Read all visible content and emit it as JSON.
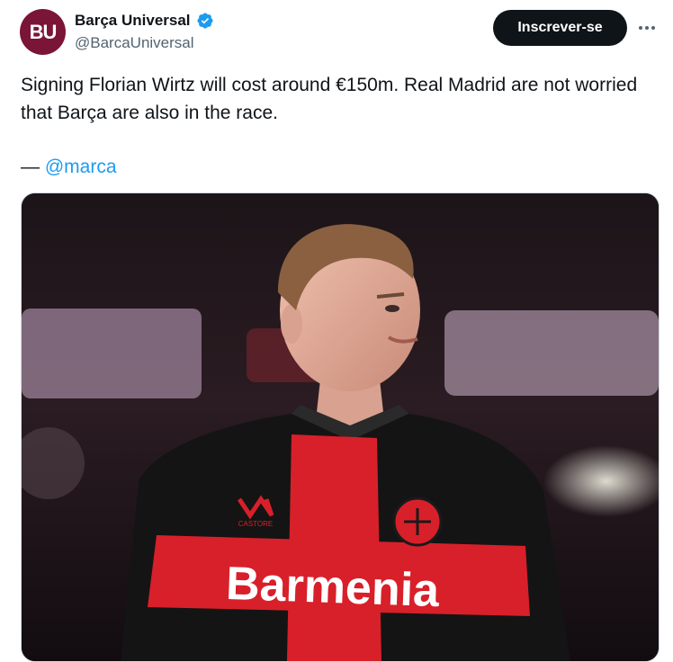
{
  "author": {
    "avatar_text": "BU",
    "name": "Barça Universal",
    "handle": "@BarcaUniversal",
    "verified_icon": "verified-badge-icon"
  },
  "actions": {
    "subscribe_label": "Inscrever-se",
    "more_icon": "more-options-icon"
  },
  "tweet": {
    "text": "Signing Florian Wirtz will cost around €150m. Real Madrid are not worried that Barça are also in the race.",
    "source_dash": "—",
    "source_mention": "@marca"
  },
  "media": {
    "shirt_sponsor": "Barmenia",
    "kit_brand": "CASTORE"
  },
  "colors": {
    "avatar_bg": "#7a1538",
    "link": "#1d9bf0",
    "verified": "#1d9bf0",
    "jersey_red": "#d8202a",
    "jersey_black": "#141414"
  }
}
